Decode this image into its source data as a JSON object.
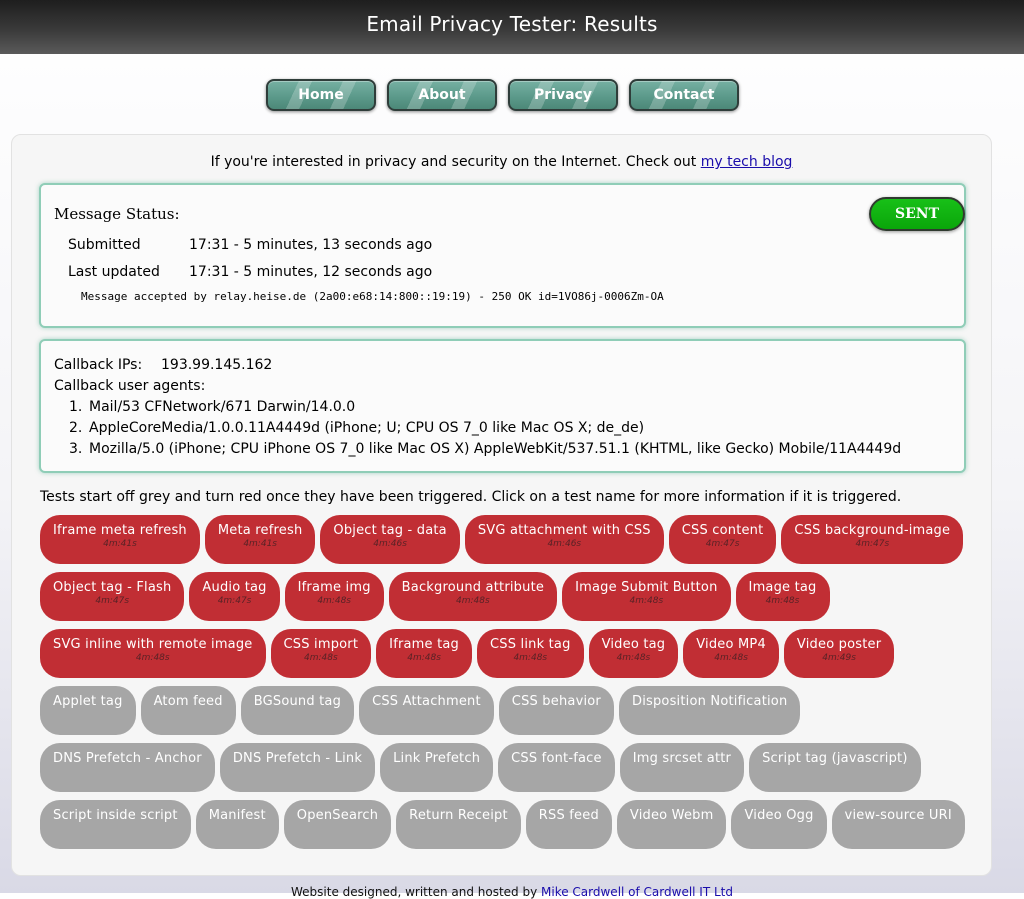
{
  "header": {
    "title": "Email Privacy Tester: Results"
  },
  "nav": [
    "Home",
    "About",
    "Privacy",
    "Contact"
  ],
  "intro": {
    "text": "If you're interested in privacy and security on the Internet. Check out ",
    "link": "my tech blog"
  },
  "status": {
    "heading": "Message Status:",
    "badge": "SENT",
    "badge_color": "#0aa60a",
    "submitted_label": "Submitted",
    "submitted_value": "17:31 - 5 minutes, 13 seconds ago",
    "updated_label": "Last updated",
    "updated_value": "17:31 - 5 minutes, 12 seconds ago",
    "relay": "Message accepted by relay.heise.de (2a00:e68:14:800::19:19) - 250 OK id=1VO86j-0006Zm-OA"
  },
  "callback": {
    "ips_label": "Callback IPs:",
    "ips_value": "193.99.145.162",
    "ua_label": "Callback user agents:",
    "agents": [
      "Mail/53 CFNetwork/671 Darwin/14.0.0",
      "AppleCoreMedia/1.0.0.11A4449d (iPhone; U; CPU OS 7_0 like Mac OS X; de_de)",
      "Mozilla/5.0 (iPhone; CPU iPhone OS 7_0 like Mac OS X) AppleWebKit/537.51.1 (KHTML, like Gecko) Mobile/11A4449d"
    ]
  },
  "tests_intro": "Tests start off grey and turn red once they have been triggered. Click on a test name for more information if it is triggered.",
  "colors": {
    "triggered": "#c12e34",
    "idle": "#a6a6a6",
    "panel_border": "#8fcdb7",
    "nav_button": "#5c9a8b"
  },
  "tests": [
    {
      "name": "Iframe meta refresh",
      "time": "4m:41s",
      "triggered": true
    },
    {
      "name": "Meta refresh",
      "time": "4m:41s",
      "triggered": true
    },
    {
      "name": "Object tag - data",
      "time": "4m:46s",
      "triggered": true
    },
    {
      "name": "SVG attachment with CSS",
      "time": "4m:46s",
      "triggered": true
    },
    {
      "name": "CSS content",
      "time": "4m:47s",
      "triggered": true
    },
    {
      "name": "CSS background-image",
      "time": "4m:47s",
      "triggered": true
    },
    {
      "name": "Object tag - Flash",
      "time": "4m:47s",
      "triggered": true
    },
    {
      "name": "Audio tag",
      "time": "4m:47s",
      "triggered": true
    },
    {
      "name": "Iframe img",
      "time": "4m:48s",
      "triggered": true
    },
    {
      "name": "Background attribute",
      "time": "4m:48s",
      "triggered": true
    },
    {
      "name": "Image Submit Button",
      "time": "4m:48s",
      "triggered": true
    },
    {
      "name": "Image tag",
      "time": "4m:48s",
      "triggered": true
    },
    {
      "name": "SVG inline with remote image",
      "time": "4m:48s",
      "triggered": true
    },
    {
      "name": "CSS import",
      "time": "4m:48s",
      "triggered": true
    },
    {
      "name": "Iframe tag",
      "time": "4m:48s",
      "triggered": true
    },
    {
      "name": "CSS link tag",
      "time": "4m:48s",
      "triggered": true
    },
    {
      "name": "Video tag",
      "time": "4m:48s",
      "triggered": true
    },
    {
      "name": "Video MP4",
      "time": "4m:48s",
      "triggered": true
    },
    {
      "name": "Video poster",
      "time": "4m:49s",
      "triggered": true
    },
    {
      "name": "Applet tag",
      "time": "",
      "triggered": false
    },
    {
      "name": "Atom feed",
      "time": "",
      "triggered": false
    },
    {
      "name": "BGSound tag",
      "time": "",
      "triggered": false
    },
    {
      "name": "CSS Attachment",
      "time": "",
      "triggered": false
    },
    {
      "name": "CSS behavior",
      "time": "",
      "triggered": false
    },
    {
      "name": "Disposition Notification",
      "time": "",
      "triggered": false
    },
    {
      "name": "DNS Prefetch - Anchor",
      "time": "",
      "triggered": false
    },
    {
      "name": "DNS Prefetch - Link",
      "time": "",
      "triggered": false
    },
    {
      "name": "Link Prefetch",
      "time": "",
      "triggered": false
    },
    {
      "name": "CSS font-face",
      "time": "",
      "triggered": false
    },
    {
      "name": "Img srcset attr",
      "time": "",
      "triggered": false
    },
    {
      "name": "Script tag (javascript)",
      "time": "",
      "triggered": false
    },
    {
      "name": "Script inside script",
      "time": "",
      "triggered": false
    },
    {
      "name": "Manifest",
      "time": "",
      "triggered": false
    },
    {
      "name": "OpenSearch",
      "time": "",
      "triggered": false
    },
    {
      "name": "Return Receipt",
      "time": "",
      "triggered": false
    },
    {
      "name": "RSS feed",
      "time": "",
      "triggered": false
    },
    {
      "name": "Video Webm",
      "time": "",
      "triggered": false
    },
    {
      "name": "Video Ogg",
      "time": "",
      "triggered": false
    },
    {
      "name": "view-source URI",
      "time": "",
      "triggered": false
    }
  ],
  "footer": {
    "text": "Website designed, written and hosted by ",
    "link": "Mike Cardwell of Cardwell IT Ltd"
  }
}
